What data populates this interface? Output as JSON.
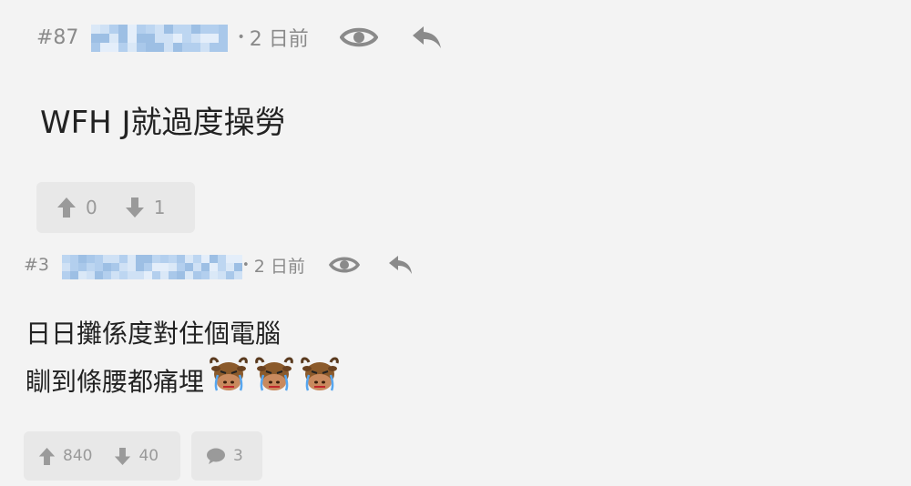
{
  "posts": [
    {
      "number": "#87",
      "separator": "•",
      "time": "2 日前",
      "body_lines": [
        "WFH J就過度操勞"
      ],
      "reactions": {
        "up": "0",
        "down": "1"
      }
    },
    {
      "number": "#3",
      "separator": "•",
      "time": "2 日前",
      "body_lines": [
        "日日攤係度對住個電腦",
        "瞓到條腰都痛埋"
      ],
      "emojis": [
        "crying-cow-emoji",
        "crying-cow-emoji",
        "crying-cow-emoji"
      ],
      "reactions": {
        "up": "840",
        "down": "40",
        "comments": "3"
      }
    }
  ],
  "icons": {
    "view": "eye-icon",
    "reply": "reply-arrow-icon",
    "upvote": "arrow-up-icon",
    "downvote": "arrow-down-icon",
    "comments": "speech-bubble-icon"
  },
  "colors": {
    "background": "#f3f3f3",
    "text": "#222222",
    "meta": "#8a8a8a",
    "button_bg": "#e8e8e8",
    "username_blur": "#bcd4ec"
  }
}
